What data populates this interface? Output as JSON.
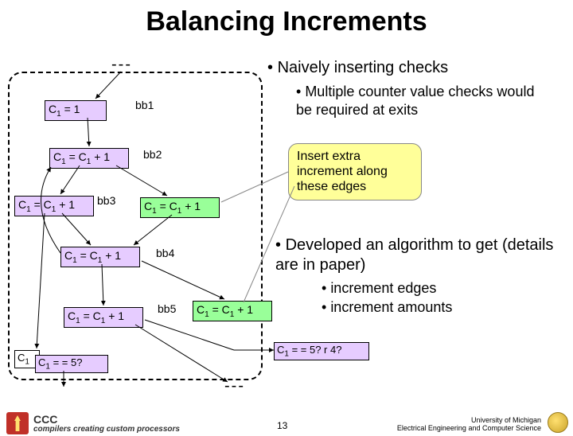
{
  "title": "Balancing Increments",
  "bullets": {
    "main": "Naively inserting checks",
    "sub": "Multiple counter value checks would be required at exits",
    "dev": "Developed an algorithm to get (details are in paper)",
    "inc_edges": "increment edges",
    "inc_amounts": "increment amounts"
  },
  "callout": {
    "line1": "Insert extra",
    "line2": "increment along",
    "line3": "these edges"
  },
  "diagram": {
    "c1_eq_1": "C",
    "c1_eq_1_rest": " = 1",
    "c_inc": "C",
    "c_inc_rest": " = C",
    "c_inc_rest2": " + 1",
    "bb1": "bb1",
    "bb2": "bb2",
    "bb3": "bb3",
    "bb4": "bb4",
    "bb5": "bb5",
    "check5": " = = 5?",
    "check5r4": " = = 5? r 4?",
    "sub1": "1"
  },
  "footer": {
    "page": "13",
    "univ1": "University of Michigan",
    "univ2": "Electrical Engineering and Computer Science",
    "logo_text": "compilers creating custom processors"
  }
}
